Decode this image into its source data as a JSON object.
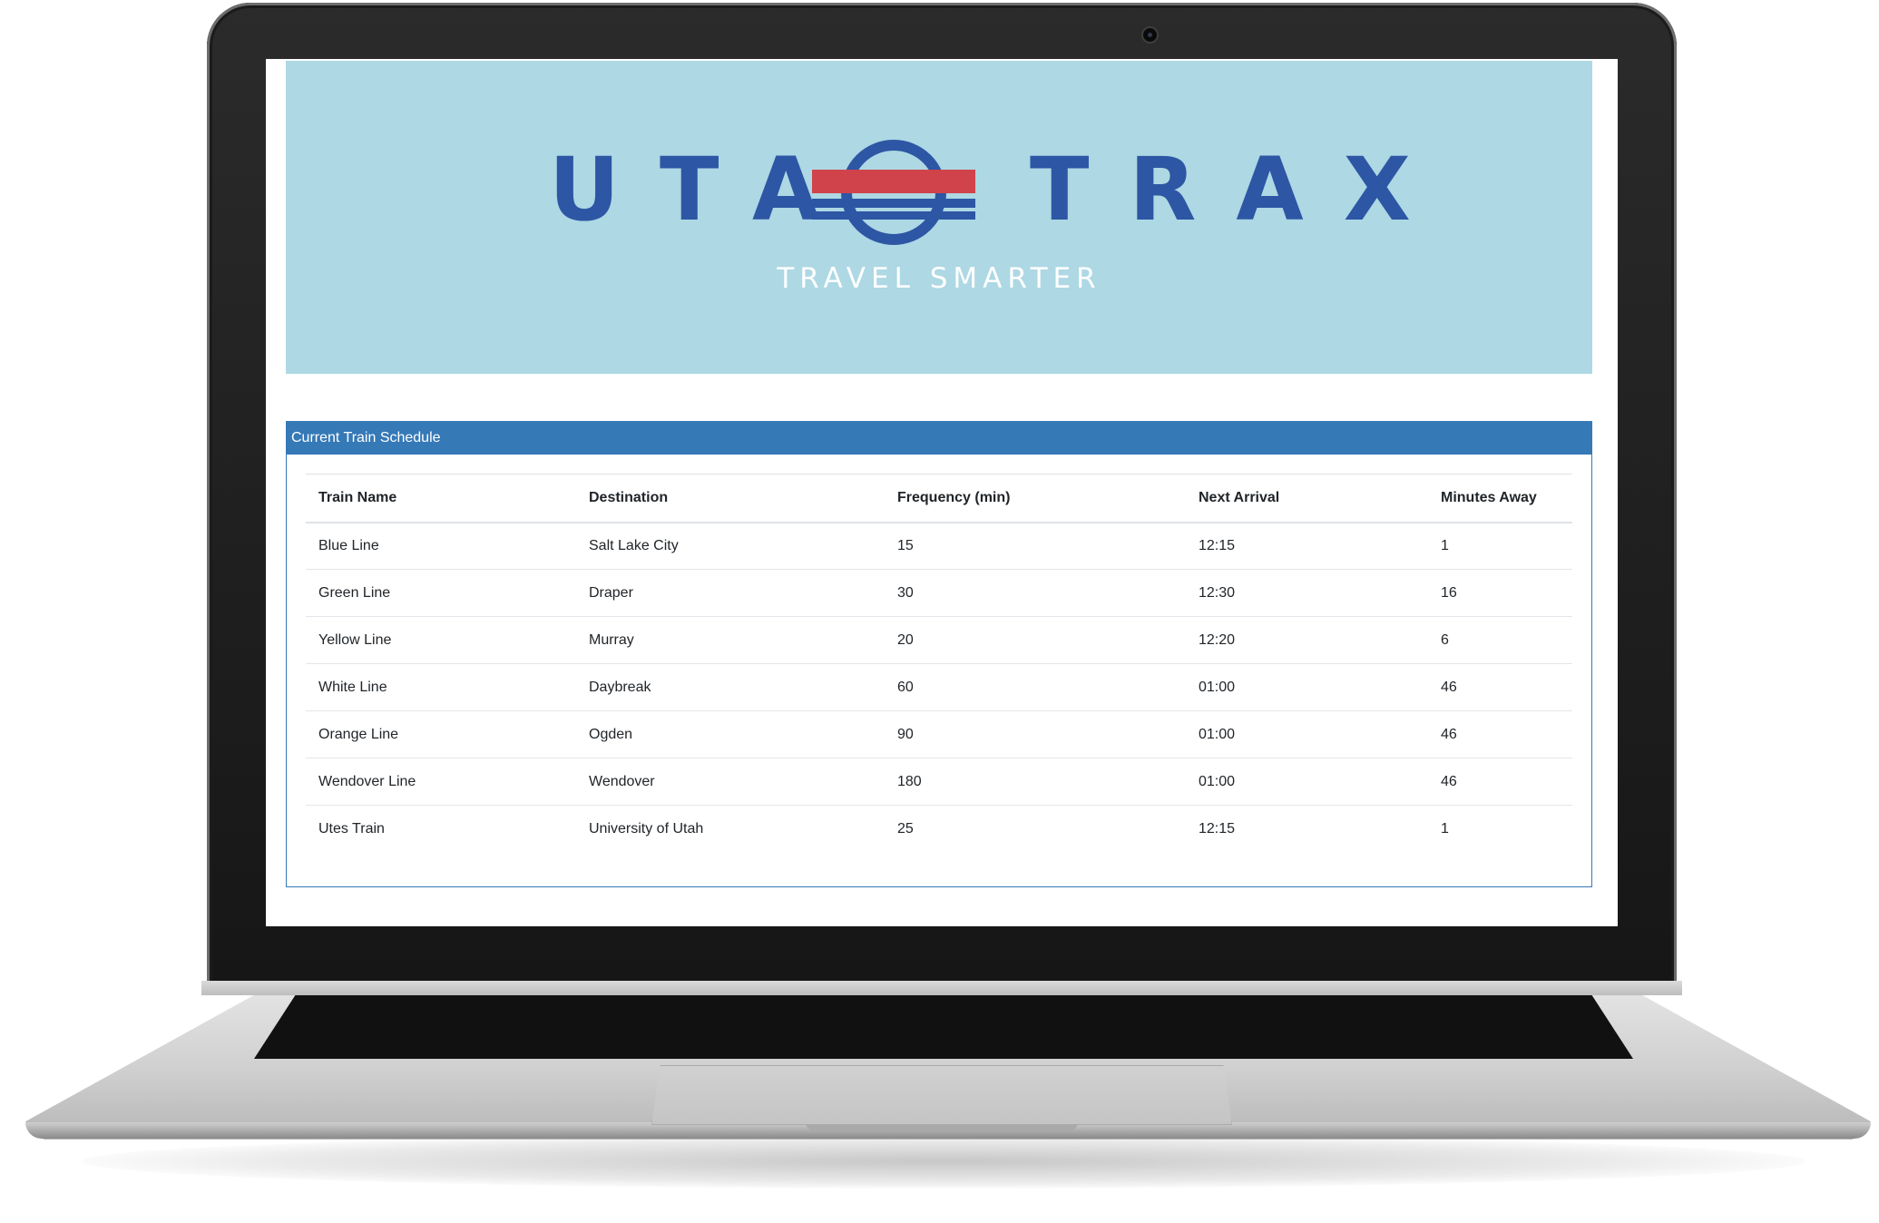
{
  "banner": {
    "logo_left": "UTA",
    "logo_right": "TRAX",
    "tagline": "TRAVEL SMARTER",
    "colors": {
      "background": "#add8e4",
      "logo_blue": "#2d56a4",
      "logo_red": "#d0434a"
    }
  },
  "schedule": {
    "title": "Current Train Schedule",
    "columns": [
      "Train Name",
      "Destination",
      "Frequency (min)",
      "Next Arrival",
      "Minutes Away"
    ],
    "rows": [
      [
        "Blue Line",
        "Salt Lake City",
        "15",
        "12:15",
        "1"
      ],
      [
        "Green Line",
        "Draper",
        "30",
        "12:30",
        "16"
      ],
      [
        "Yellow Line",
        "Murray",
        "20",
        "12:20",
        "6"
      ],
      [
        "White Line",
        "Daybreak",
        "60",
        "01:00",
        "46"
      ],
      [
        "Orange Line",
        "Ogden",
        "90",
        "01:00",
        "46"
      ],
      [
        "Wendover Line",
        "Wendover",
        "180",
        "01:00",
        "46"
      ],
      [
        "Utes Train",
        "University of Utah",
        "25",
        "12:15",
        "1"
      ]
    ],
    "colors": {
      "accent": "#3579b7"
    }
  },
  "device": {
    "icons": [
      "camera-icon"
    ]
  }
}
